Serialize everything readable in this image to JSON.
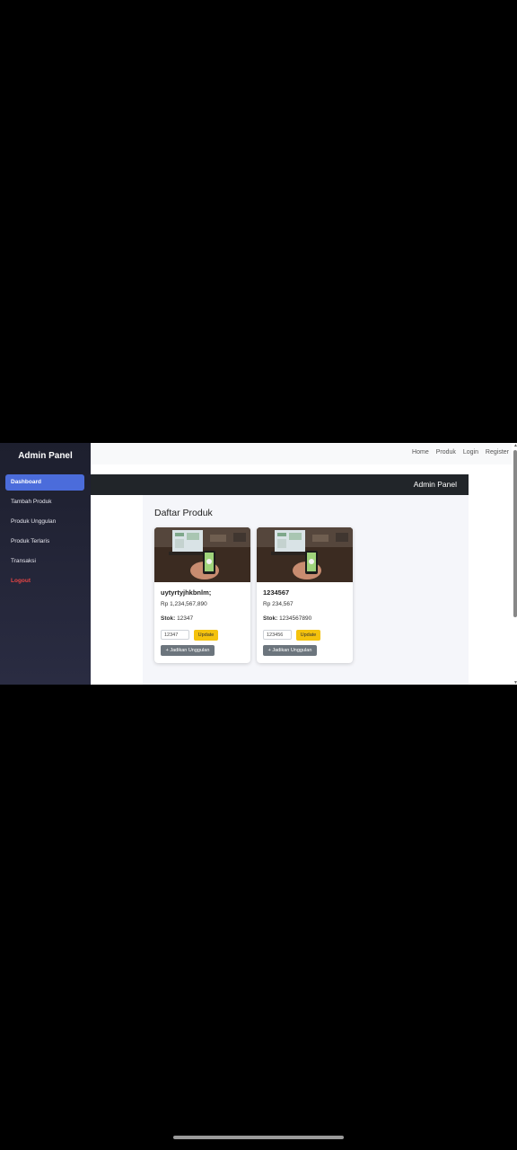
{
  "sidebar": {
    "title": "Admin Panel",
    "items": [
      {
        "label": "Dashboard"
      },
      {
        "label": "Tambah Produk"
      },
      {
        "label": "Produk Unggulan"
      },
      {
        "label": "Produk Terlaris"
      },
      {
        "label": "Transaksi"
      },
      {
        "label": "Logout"
      }
    ]
  },
  "topnav": {
    "links": [
      "Home",
      "Produk",
      "Login",
      "Register"
    ]
  },
  "header": {
    "title": "Admin Panel"
  },
  "main": {
    "title": "Daftar Produk",
    "products": [
      {
        "name": "uytyrtyjhkbnlm;",
        "price": "Rp 1,234,567,890",
        "stock_label": "Stok:",
        "stock_value": "12347",
        "input_value": "12347",
        "update_label": "Update",
        "feature_label": "+ Jadikan Unggulan"
      },
      {
        "name": "1234567",
        "price": "Rp 234,567",
        "stock_label": "Stok:",
        "stock_value": "1234567890",
        "input_value": "123456",
        "update_label": "Update",
        "feature_label": "+ Jadikan Unggulan"
      }
    ]
  },
  "colors": {
    "sidebar_bg": "#1d1f2e",
    "active_item": "#4b6cdb",
    "logout": "#e64545",
    "update_button": "#f4c20d",
    "feature_button": "#6c757d",
    "dark_header": "#212529"
  }
}
